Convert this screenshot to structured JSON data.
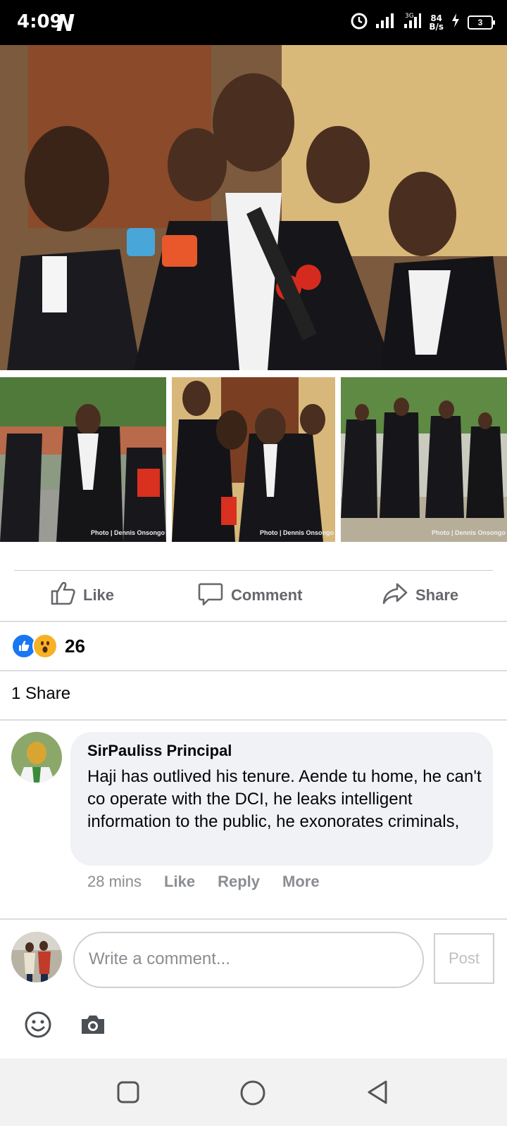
{
  "status_bar": {
    "time": "4:09",
    "network_speed_value": "84",
    "network_speed_unit": "B/s",
    "network_type": "3G",
    "battery": "3"
  },
  "post": {
    "photo_credit": "Photo | Dennis Onsongo",
    "actions": {
      "like": "Like",
      "comment": "Comment",
      "share": "Share"
    },
    "reaction_count": "26",
    "share_count": "1 Share"
  },
  "comment": {
    "author": "SirPauliss Principal",
    "text": "Haji has outlived his tenure. Aende tu home, he can't co operate with the DCI, he leaks intelligent information to the public, he exonorates criminals,",
    "time": "28 mins",
    "like": "Like",
    "reply": "Reply",
    "more": "More"
  },
  "composer": {
    "placeholder": "Write a comment...",
    "post_label": "Post"
  },
  "colors": {
    "like_blue": "#1877f2",
    "wow_yellow": "#f7b125",
    "icon_gray": "#65676b"
  }
}
